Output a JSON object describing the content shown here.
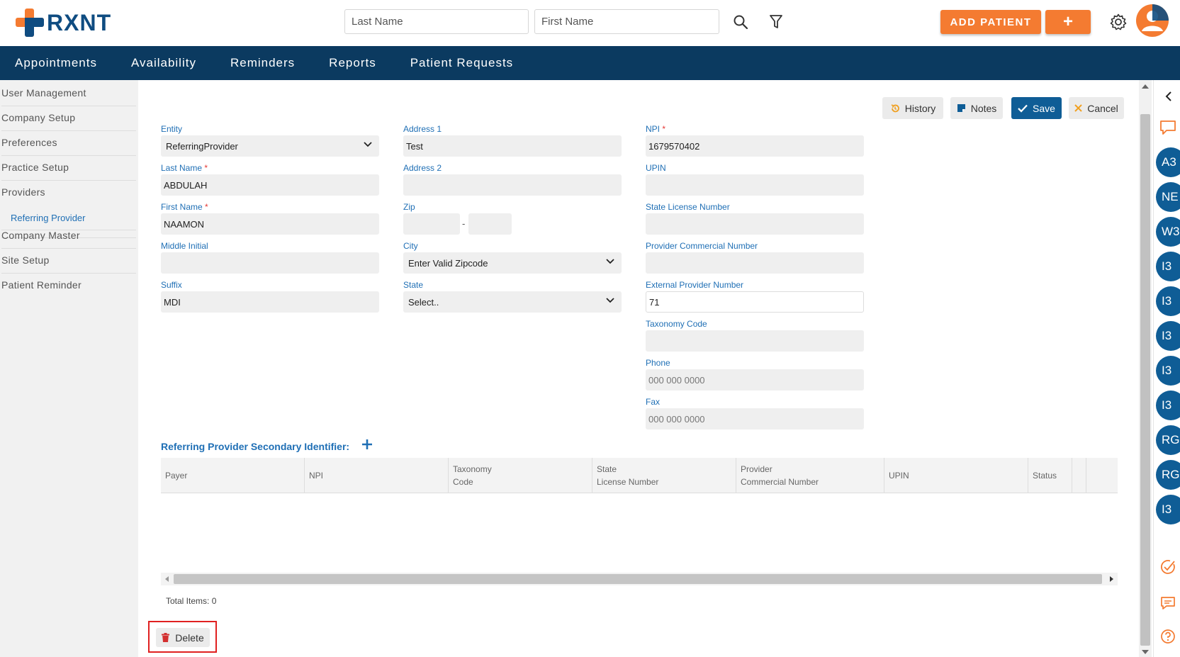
{
  "brand": {
    "name": "RXNT"
  },
  "header": {
    "last_name_placeholder": "Last Name",
    "first_name_placeholder": "First Name",
    "add_patient_label": "ADD PATIENT",
    "add_plus_label": "+"
  },
  "nav": [
    "Appointments",
    "Availability",
    "Reminders",
    "Reports",
    "Patient Requests"
  ],
  "sidebar": {
    "items": [
      "User Management",
      "Company Setup",
      "Preferences",
      "Practice Setup",
      "Providers",
      "Company Master",
      "Site Setup",
      "Patient Reminder"
    ],
    "sub_item": "Referring Provider"
  },
  "toolbar": {
    "history": "History",
    "notes": "Notes",
    "save": "Save",
    "cancel": "Cancel"
  },
  "form": {
    "entity": {
      "label": "Entity",
      "value": "ReferringProvider"
    },
    "last_name": {
      "label": "Last Name",
      "value": "ABDULAH"
    },
    "first_name": {
      "label": "First Name",
      "value": "NAAMON"
    },
    "middle_initial": {
      "label": "Middle Initial",
      "value": ""
    },
    "suffix": {
      "label": "Suffix",
      "value": "MDI"
    },
    "address1": {
      "label": "Address 1",
      "value": "Test"
    },
    "address2": {
      "label": "Address 2",
      "value": ""
    },
    "zip": {
      "label": "Zip",
      "separator": "-",
      "value1": "",
      "value2": ""
    },
    "city": {
      "label": "City",
      "value": "Enter Valid Zipcode"
    },
    "state": {
      "label": "State",
      "value": "Select.."
    },
    "npi": {
      "label": "NPI",
      "value": "1679570402"
    },
    "upin": {
      "label": "UPIN",
      "value": ""
    },
    "state_license": {
      "label": "State License Number",
      "value": ""
    },
    "provider_commercial": {
      "label": "Provider Commercial Number",
      "value": ""
    },
    "external_provider": {
      "label": "External Provider Number",
      "value": "71"
    },
    "taxonomy": {
      "label": "Taxonomy Code",
      "value": ""
    },
    "phone": {
      "label": "Phone",
      "placeholder": "000 000 0000"
    },
    "fax": {
      "label": "Fax",
      "placeholder": "000 000 0000"
    },
    "required_mark": "*"
  },
  "secondary": {
    "title": "Referring Provider Secondary Identifier:",
    "columns": [
      {
        "line1": "Payer",
        "line2": ""
      },
      {
        "line1": "NPI",
        "line2": ""
      },
      {
        "line1": "Taxonomy",
        "line2": "Code"
      },
      {
        "line1": "State",
        "line2": "License Number"
      },
      {
        "line1": "Provider",
        "line2": "Commercial Number"
      },
      {
        "line1": "UPIN",
        "line2": ""
      },
      {
        "line1": "Status",
        "line2": ""
      }
    ],
    "total_items": "Total Items: 0"
  },
  "delete_label": "Delete",
  "rail": {
    "badges": [
      "A3",
      "NE",
      "W3",
      "I3",
      "I3",
      "I3",
      "I3",
      "I3",
      "RG",
      "RG",
      "I3"
    ]
  },
  "colors": {
    "brand_orange": "#f47b31",
    "brand_navy": "#0b3a60",
    "link_blue": "#1f6fb5",
    "save_blue": "#0f5d96",
    "badge_blue": "#0f5d96"
  }
}
